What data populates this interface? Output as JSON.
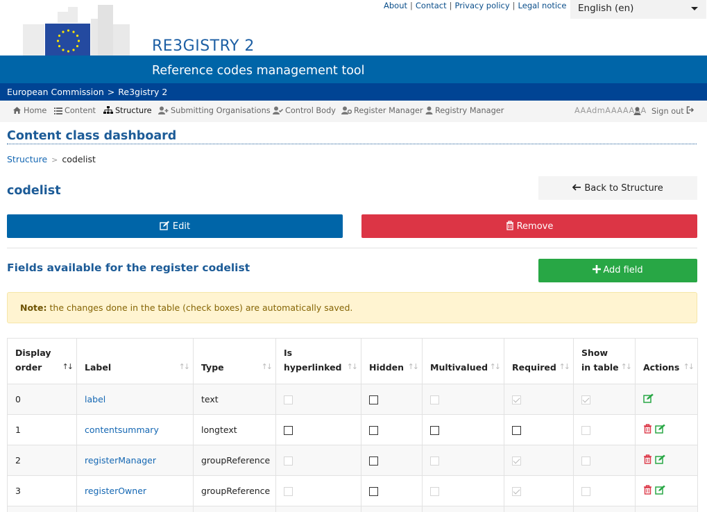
{
  "header": {
    "logo_text": "European Commission",
    "top_links": [
      "About",
      "Contact",
      "Privacy policy",
      "Legal notice"
    ],
    "language": "English (en)",
    "app_name": "RE3GISTRY 2",
    "subtitle": "Reference codes management tool",
    "breadcrumb": [
      "European Commission",
      "Re3gistry 2"
    ]
  },
  "menu": {
    "items": [
      "Home",
      "Content",
      "Structure",
      "Submitting Organisations",
      "Control Body",
      "Register Manager",
      "Registry Manager"
    ],
    "active": "Structure",
    "user": "AAAdmAAAAAAA",
    "signout": "Sign out"
  },
  "page": {
    "title": "Content class dashboard",
    "crumb_link": "Structure",
    "crumb_current": "codelist",
    "entity": "codelist",
    "back_label": "Back to Structure",
    "edit_label": "Edit",
    "remove_label": "Remove",
    "fields_title": "Fields available for the register codelist",
    "add_label": "Add field",
    "note_bold": "Note:",
    "note_text": " the changes done in the table (check boxes) are automatically saved."
  },
  "table": {
    "headers": {
      "display_order_1": "Display",
      "display_order_2": "order",
      "label": "Label",
      "type": "Type",
      "hyperlinked_1": "Is",
      "hyperlinked_2": "hyperlinked",
      "hidden": "Hidden",
      "multivalued": "Multivalued",
      "required": "Required",
      "show_1": "Show",
      "show_2": "in table",
      "actions": "Actions"
    },
    "rows": [
      {
        "order": "0",
        "label": "label",
        "type": "text"
      },
      {
        "order": "1",
        "label": "contentsummary",
        "type": "longtext"
      },
      {
        "order": "2",
        "label": "registerManager",
        "type": "groupReference"
      },
      {
        "order": "3",
        "label": "registerOwner",
        "type": "groupReference"
      }
    ]
  },
  "colors": {
    "primary": "#0065a8",
    "dark_band": "#004494",
    "danger": "#dc3545",
    "success": "#28a745",
    "title": "#1c5b97"
  }
}
